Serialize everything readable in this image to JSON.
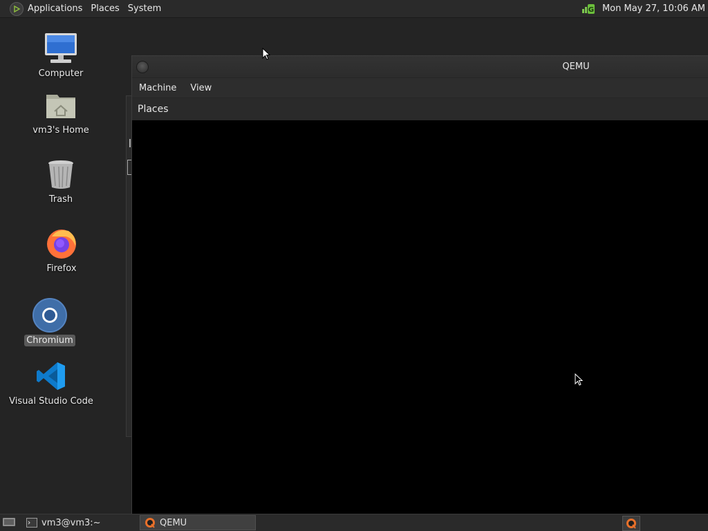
{
  "top_panel": {
    "menus": [
      "Applications",
      "Places",
      "System"
    ],
    "clock": "Mon May 27, 10:06 AM"
  },
  "desktop": {
    "icons": [
      {
        "label": "Computer",
        "icon": "computer-icon"
      },
      {
        "label": "vm3's Home",
        "icon": "home-folder-icon"
      },
      {
        "label": "Trash",
        "icon": "trash-icon"
      },
      {
        "label": "Firefox",
        "icon": "firefox-icon"
      },
      {
        "label": "Chromium",
        "icon": "chromium-icon",
        "selected": true
      },
      {
        "label": "Visual Studio Code",
        "icon": "vscode-icon"
      }
    ]
  },
  "qemu_window": {
    "title": "QEMU",
    "menus": [
      "Machine",
      "View"
    ],
    "places_label": "Places"
  },
  "taskbar": {
    "items": [
      {
        "label": "vm3@vm3:~",
        "icon": "terminal-icon"
      },
      {
        "label": "QEMU",
        "icon": "qemu-icon",
        "active": true
      }
    ]
  },
  "colors": {
    "panel": "#2a2a2a",
    "desktop": "#242424",
    "vm_screen": "#000000",
    "network_green": "#4caf50"
  }
}
